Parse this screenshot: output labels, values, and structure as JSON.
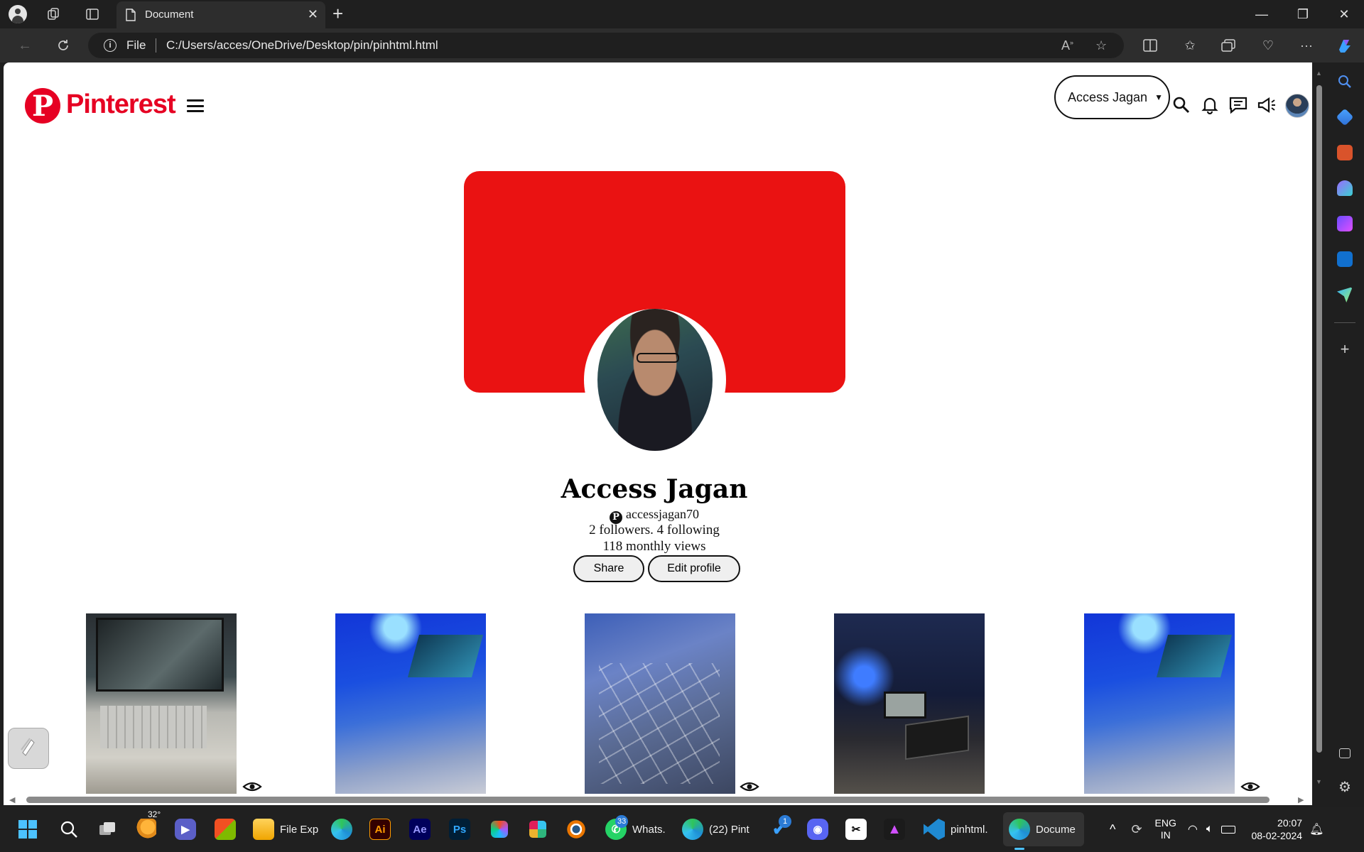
{
  "browser": {
    "tab_title": "Document",
    "address_scheme_label": "File",
    "url": "C:/Users/acces/OneDrive/Desktop/pin/pinhtml.html"
  },
  "page": {
    "logo_text": "Pinterest",
    "account_select_value": "Access Jagan",
    "profile": {
      "name": "Access Jagan",
      "handle": "accessjagan70",
      "followers_line": "2 followers. 4 following",
      "views_line": "118 monthly views",
      "share_label": "Share",
      "edit_label": "Edit profile"
    },
    "colors": {
      "brand_red": "#e60023",
      "cover_red": "#ea1212"
    },
    "pins": [
      {
        "name": "pin-laptop-keyboard-wallpaper"
      },
      {
        "name": "pin-laptop-blue-light"
      },
      {
        "name": "pin-numpad-closeup"
      },
      {
        "name": "pin-desk-setup"
      },
      {
        "name": "pin-laptop-blue-light-2"
      }
    ]
  },
  "taskbar": {
    "weather_temp": "32°",
    "file_explorer_label": "File Exp",
    "whatsapp_label": "Whats.",
    "whatsapp_badge": "33",
    "edge_pinterest_label": "(22) Pint",
    "todo_badge": "1",
    "vscode_label": "pinhtml.",
    "edge_doc_label": "Docume",
    "lang_line1": "ENG",
    "lang_line2": "IN",
    "time": "20:07",
    "date": "08-02-2024",
    "app_icons": [
      "start-icon",
      "search-icon",
      "task-view-icon",
      "weather-icon",
      "teams-icon",
      "store-icon",
      "file-explorer-icon",
      "edge-icon",
      "illustrator-icon",
      "after-effects-icon",
      "photoshop-icon",
      "figma-icon",
      "slack-icon",
      "blender-icon",
      "whatsapp-icon",
      "edge-pinterest-icon",
      "todo-icon",
      "discord-icon",
      "capcut-icon",
      "affinity-icon",
      "vscode-icon",
      "edge-document-icon"
    ],
    "illustrator_text": "Ai",
    "after_effects_text": "Ae",
    "photoshop_text": "Ps"
  }
}
